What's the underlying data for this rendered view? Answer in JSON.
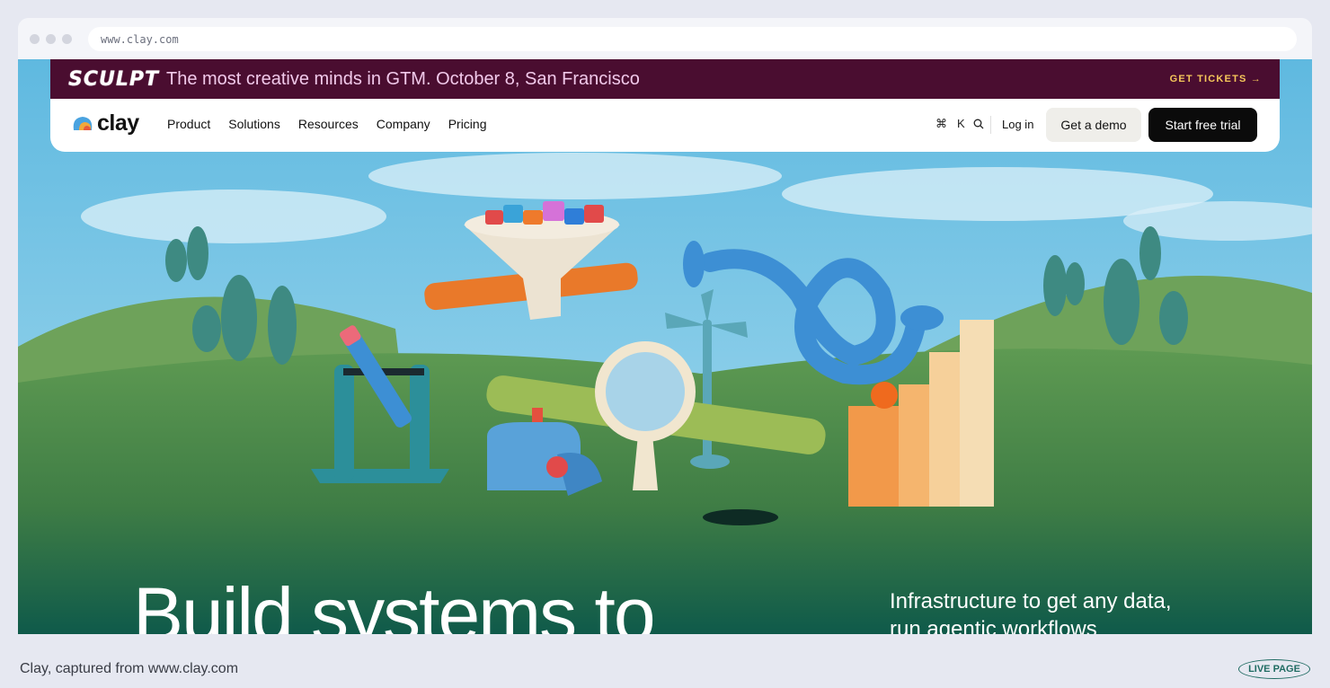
{
  "browser": {
    "url": "www.clay.com"
  },
  "banner": {
    "logo_text": "SCULPT",
    "message": "The most creative minds in GTM. October 8, San Francisco",
    "cta": "GET TICKETS →"
  },
  "nav": {
    "brand": "clay",
    "items": [
      {
        "label": "Product"
      },
      {
        "label": "Solutions"
      },
      {
        "label": "Resources"
      },
      {
        "label": "Company"
      },
      {
        "label": "Pricing"
      }
    ],
    "shortcut_cmd": "⌘",
    "shortcut_key": "K",
    "login": "Log in",
    "demo": "Get a demo",
    "trial": "Start free trial"
  },
  "hero": {
    "headline": "Build systems to",
    "subhead": "Infrastructure to get any data, run agentic workflows"
  },
  "footer": {
    "caption": "Clay, captured from www.clay.com",
    "badge": "LIVE PAGE"
  },
  "colors": {
    "banner_bg": "#4a0d30",
    "banner_text": "#f1c9ea",
    "tickets": "#f6c85a",
    "trial_bg": "#0b0b0b",
    "hero_green": "#0f5a4a",
    "sky": "#7cc6e6"
  }
}
